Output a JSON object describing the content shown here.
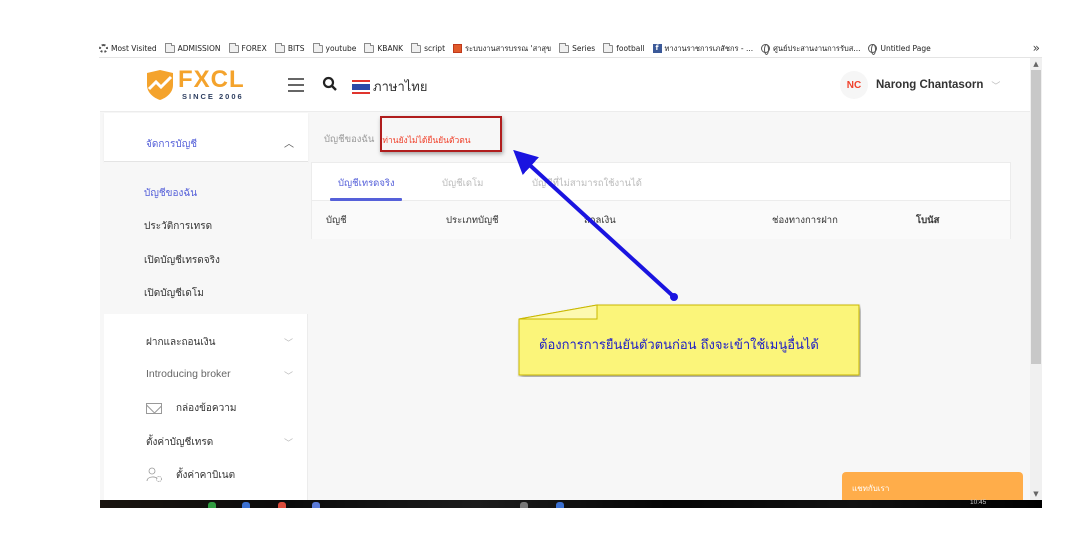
{
  "browser": {
    "bookmarks": [
      {
        "label": "Most Visited",
        "icon": "gear-icon"
      },
      {
        "label": "ADMISSION",
        "icon": "folder-icon"
      },
      {
        "label": "FOREX",
        "icon": "folder-icon"
      },
      {
        "label": "BITS",
        "icon": "folder-icon"
      },
      {
        "label": "youtube",
        "icon": "folder-icon"
      },
      {
        "label": "KBANK",
        "icon": "folder-icon"
      },
      {
        "label": "script",
        "icon": "folder-icon"
      },
      {
        "label": "ระบบงานสารบรรณ 'สาสุข",
        "icon": "app-icon"
      },
      {
        "label": "Series",
        "icon": "folder-icon"
      },
      {
        "label": "football",
        "icon": "folder-icon"
      },
      {
        "label": "ทางานราชการเภสัชกร - ...",
        "icon": "facebook-icon"
      },
      {
        "label": "ศูนย์ประสานงานการรับส...",
        "icon": "globe-icon"
      },
      {
        "label": "Untitled Page",
        "icon": "globe-icon"
      }
    ],
    "more_label": "»"
  },
  "header": {
    "logo_text": "FXCL",
    "logo_since": "SINCE 2006",
    "language": "ภาษาไทย",
    "user_initials": "NC",
    "user_name": "Narong Chantasorn",
    "colors": {
      "brand": "#f4a32c",
      "brand_dark": "#2d3e60",
      "accent": "#5560d9",
      "alert": "#f0412b"
    }
  },
  "sidebar": {
    "group": {
      "label": "จัดการบัญชี",
      "expanded": true
    },
    "sub_items": [
      {
        "label": "บัญชีของฉัน",
        "active": true
      },
      {
        "label": "ประวัติการเทรด",
        "active": false
      },
      {
        "label": "เปิดบัญชีเทรดจริง",
        "active": false
      },
      {
        "label": "เปิดบัญชีเดโม",
        "active": false
      }
    ],
    "items": [
      {
        "label": "ฝากและถอนเงิน",
        "has_chevron": true
      },
      {
        "label": "Introducing broker",
        "has_chevron": true
      },
      {
        "label": "กล่องข้อความ",
        "icon": "envelope-icon"
      },
      {
        "label": "ตั้งค่าบัญชีเทรด",
        "has_chevron": true
      },
      {
        "label": "ตั้งค่าคาบิเนต",
        "icon": "user-settings-icon"
      }
    ]
  },
  "main": {
    "breadcrumb": "บัญชีของฉัน",
    "warning": "ท่านยังไม่ได้ยืนยันตัวตน",
    "tabs": [
      {
        "label": "บัญชีเทรดจริง",
        "active": true
      },
      {
        "label": "บัญชีเดโม",
        "active": false
      },
      {
        "label": "บัญชีที่ไม่สามารถใช้งานได้",
        "active": false
      }
    ],
    "columns": [
      "บัญชี",
      "ประเภทบัญชี",
      "สกุลเงิน",
      "ช่องทางการฝาก",
      "โบนัส"
    ]
  },
  "chat": {
    "label": "แชทกับเรา"
  },
  "taskbar": {
    "clock": "10:45"
  },
  "annotation": {
    "callout_text": "ต้องการการยืนยันตัวตนก่อน ถึงจะเข้าใช้เมนูอื่นได้",
    "arrow_color": "#1a14e0",
    "callout_bg": "#fbf57a",
    "box_color": "#b01d1d"
  }
}
